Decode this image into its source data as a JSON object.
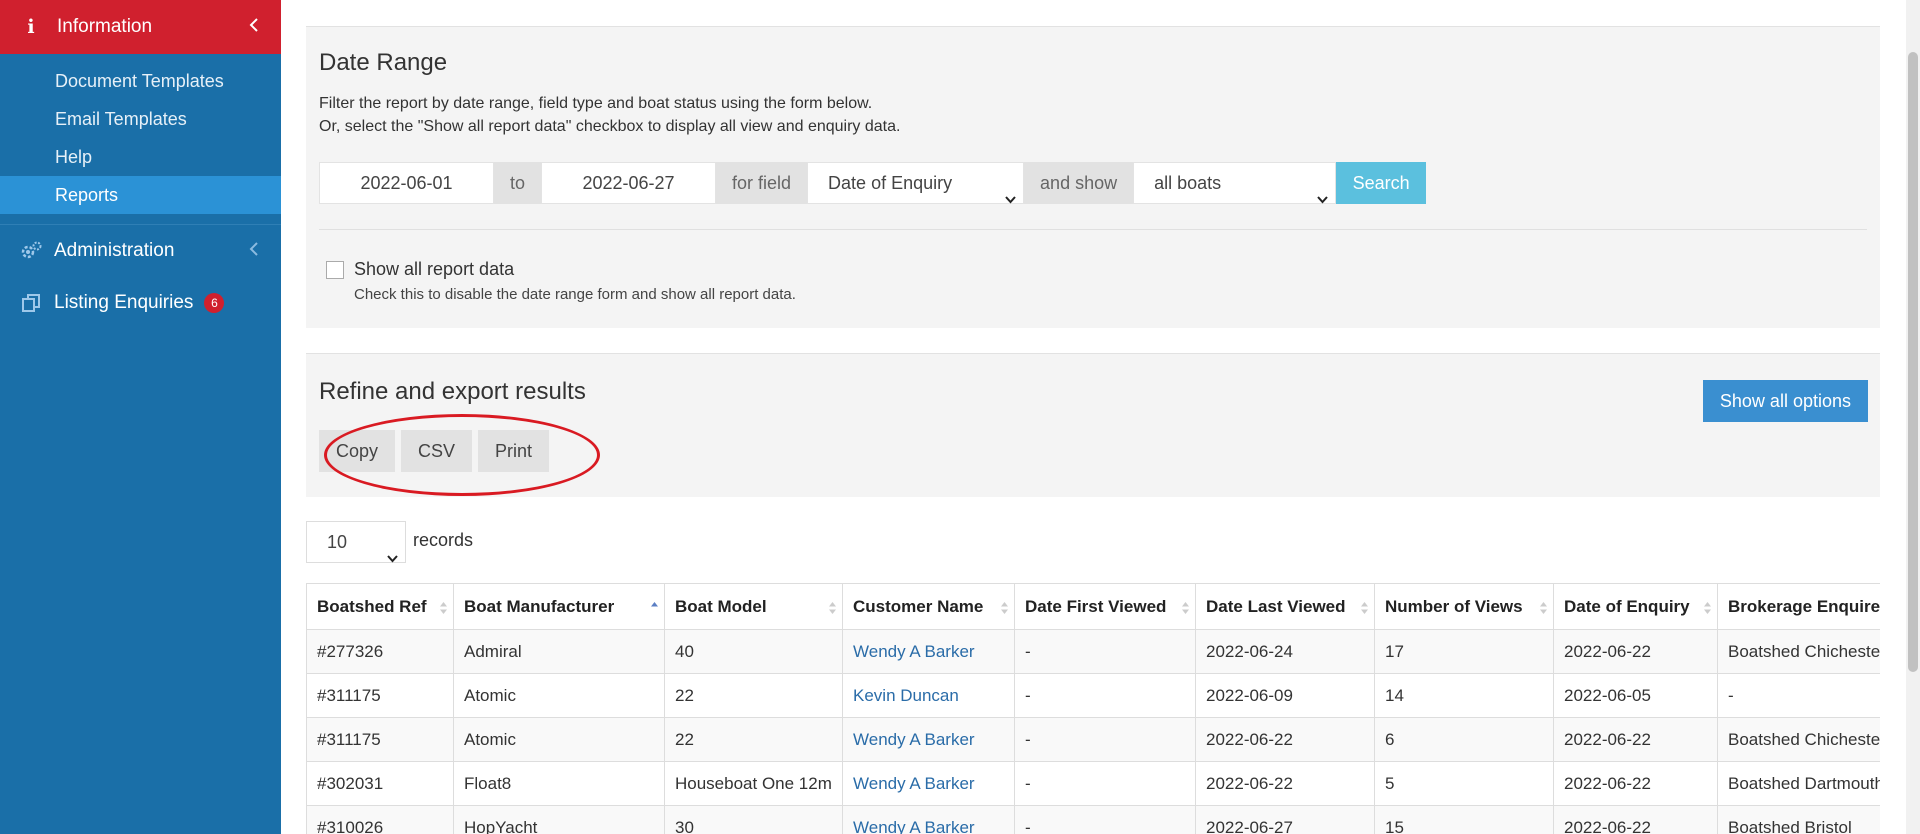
{
  "sidebar": {
    "header": {
      "label": "Information",
      "icon": "info-icon"
    },
    "subitems": [
      {
        "label": "Document Templates",
        "active": false
      },
      {
        "label": "Email Templates",
        "active": false
      },
      {
        "label": "Help",
        "active": false
      },
      {
        "label": "Reports",
        "active": true
      }
    ],
    "administration": {
      "label": "Administration",
      "icon": "gears-icon"
    },
    "listing_enquiries": {
      "label": "Listing Enquiries",
      "icon": "copy-icon",
      "badge": "6"
    }
  },
  "date_range": {
    "title": "Date Range",
    "desc_line1": "Filter the report by date range, field type and boat status using the form below.",
    "desc_line2": "Or, select the \"Show all report data\" checkbox to display all view and enquiry data.",
    "from_date": "2022-06-01",
    "to_label": "to",
    "to_date": "2022-06-27",
    "for_field_label": "for field",
    "field_value": "Date of Enquiry",
    "and_show_label": "and show",
    "show_value": "all boats",
    "search_label": "Search",
    "show_all_label": "Show all report data",
    "show_all_help": "Check this to disable the date range form and show all report data."
  },
  "refine": {
    "title": "Refine and export results",
    "copy_label": "Copy",
    "csv_label": "CSV",
    "print_label": "Print",
    "show_all_options_label": "Show all options"
  },
  "records": {
    "length": "10",
    "label": "records"
  },
  "table": {
    "headers": [
      "Boatshed Ref",
      "Boat Manufacturer",
      "Boat Model",
      "Customer Name",
      "Date First Viewed",
      "Date Last Viewed",
      "Number of Views",
      "Date of Enquiry",
      "Brokerage Enquired"
    ],
    "rows": [
      [
        "#277326",
        "Admiral",
        "40",
        "Wendy A Barker",
        "-",
        "2022-06-24",
        "17",
        "2022-06-22",
        "Boatshed Chichester"
      ],
      [
        "#311175",
        "Atomic",
        "22",
        "Kevin Duncan",
        "-",
        "2022-06-09",
        "14",
        "2022-06-05",
        "-"
      ],
      [
        "#311175",
        "Atomic",
        "22",
        "Wendy A Barker",
        "-",
        "2022-06-22",
        "6",
        "2022-06-22",
        "Boatshed Chichester"
      ],
      [
        "#302031",
        "Float8",
        "Houseboat One 12m",
        "Wendy A Barker",
        "-",
        "2022-06-22",
        "5",
        "2022-06-22",
        "Boatshed Dartmouth"
      ],
      [
        "#310026",
        "HopYacht",
        "30",
        "Wendy A Barker",
        "-",
        "2022-06-27",
        "15",
        "2022-06-22",
        "Boatshed Bristol"
      ]
    ]
  },
  "colors": {
    "sidebar_bg": "#1a6fa8",
    "header_red": "#d0202e",
    "active_item": "#2b92d6",
    "search_button": "#5bc0de",
    "primary_button": "#3a8fd0",
    "link": "#2a6ca8",
    "annotation_circle": "#d91a22"
  }
}
